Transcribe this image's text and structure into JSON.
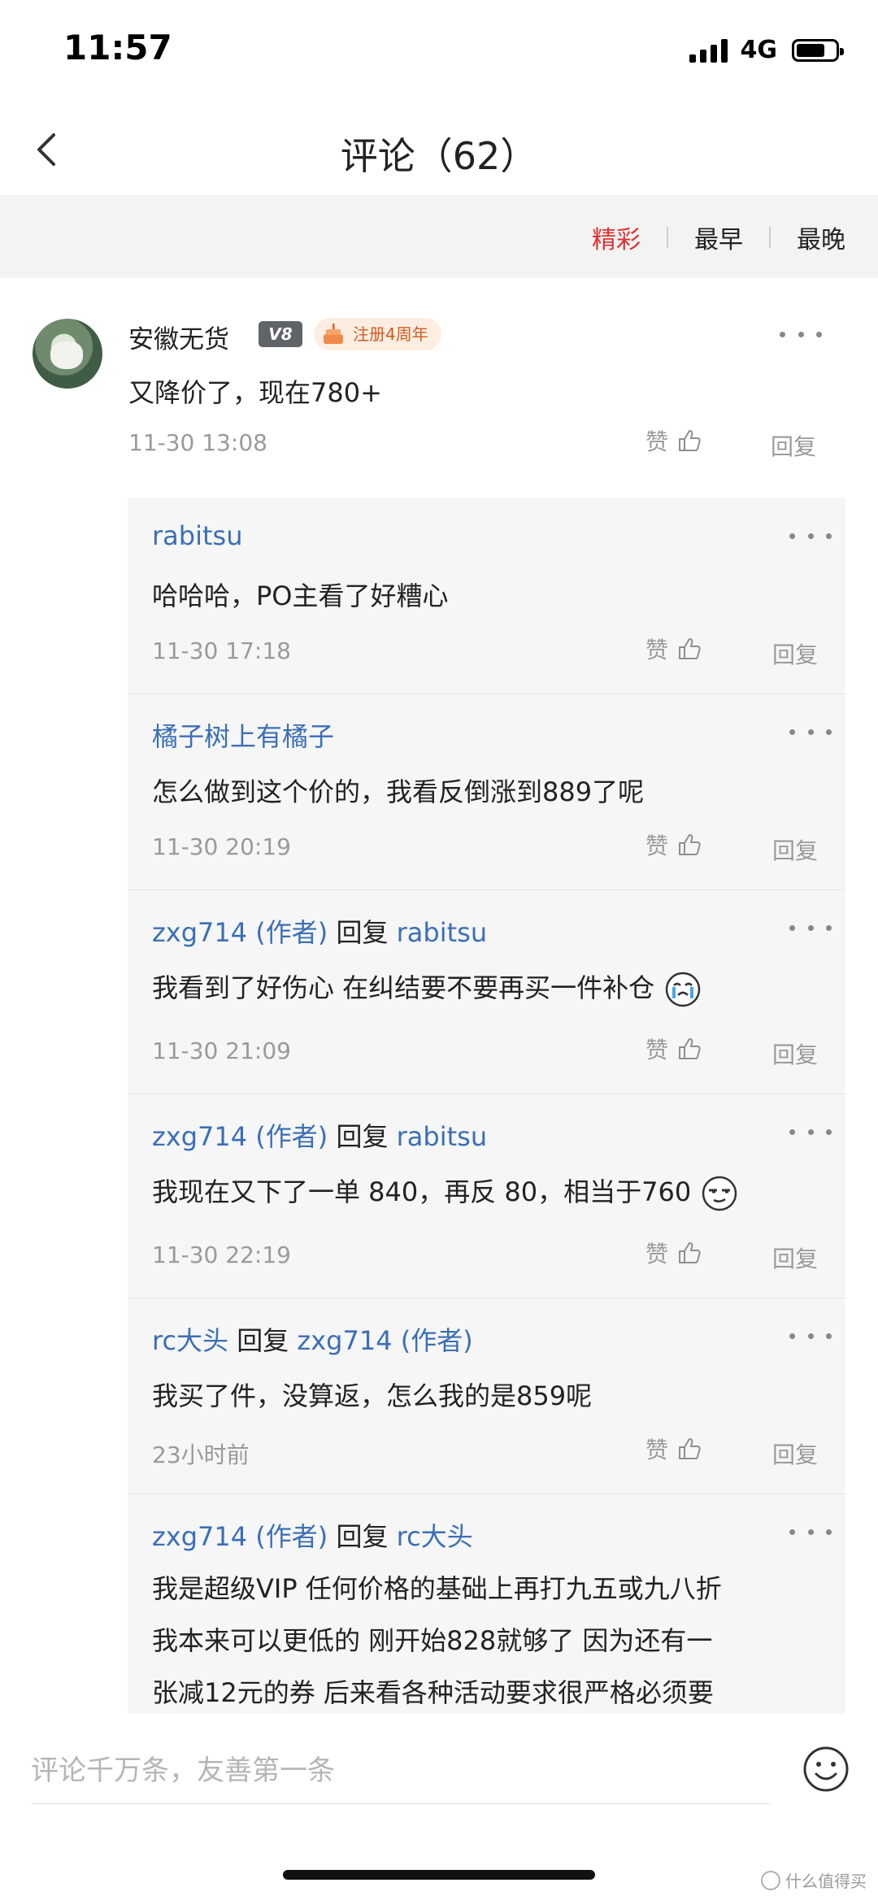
{
  "status": {
    "time": "11:57",
    "network": "4G"
  },
  "header": {
    "title": "评论（62）"
  },
  "sort_tabs": [
    {
      "label": "精彩",
      "active": true
    },
    {
      "label": "最早",
      "active": false
    },
    {
      "label": "最晚",
      "active": false
    }
  ],
  "main_comment": {
    "username": "安徽无货",
    "level": "V8",
    "anniversary": "注册4周年",
    "text": "又降价了，现在780+",
    "time": "11-30 13:08",
    "like_label": "赞",
    "reply_label": "回复"
  },
  "replies": [
    {
      "user": "rabitsu",
      "reply_word": "",
      "target": "",
      "text": "哈哈哈，PO主看了好糟心",
      "emoji": "",
      "time": "11-30 17:18"
    },
    {
      "user": "橘子树上有橘子",
      "reply_word": "",
      "target": "",
      "text": "怎么做到这个价的，我看反倒涨到889了呢",
      "emoji": "",
      "time": "11-30 20:19"
    },
    {
      "user": "zxg714 (作者)",
      "reply_word": "回复",
      "target": "rabitsu",
      "text": "我看到了好伤心 在纠结要不要再买一件补仓",
      "emoji": "crying-emoji",
      "time": "11-30 21:09"
    },
    {
      "user": "zxg714 (作者)",
      "reply_word": "回复",
      "target": "rabitsu",
      "text": "我现在又下了一单 840，再反 80，相当于760",
      "emoji": "smirk-emoji",
      "time": "11-30 22:19"
    },
    {
      "user": "rc大头",
      "reply_word": "回复",
      "target": "zxg714 (作者)",
      "text": "我买了件，没算返，怎么我的是859呢",
      "emoji": "",
      "time": "23小时前"
    },
    {
      "user": "zxg714 (作者)",
      "reply_word": "回复",
      "target": "rc大头",
      "text_lines": [
        "我是超级VIP 任何价格的基础上再打九五或九八折",
        "我本来可以更低的 刚开始828就够了 因为还有一",
        "张减12元的券 后来看各种活动要求很严格必须要"
      ],
      "time": ""
    }
  ],
  "actions": {
    "like": "赞",
    "reply": "回复"
  },
  "input": {
    "placeholder": "评论千万条，友善第一条"
  },
  "watermark": "什么值得买"
}
